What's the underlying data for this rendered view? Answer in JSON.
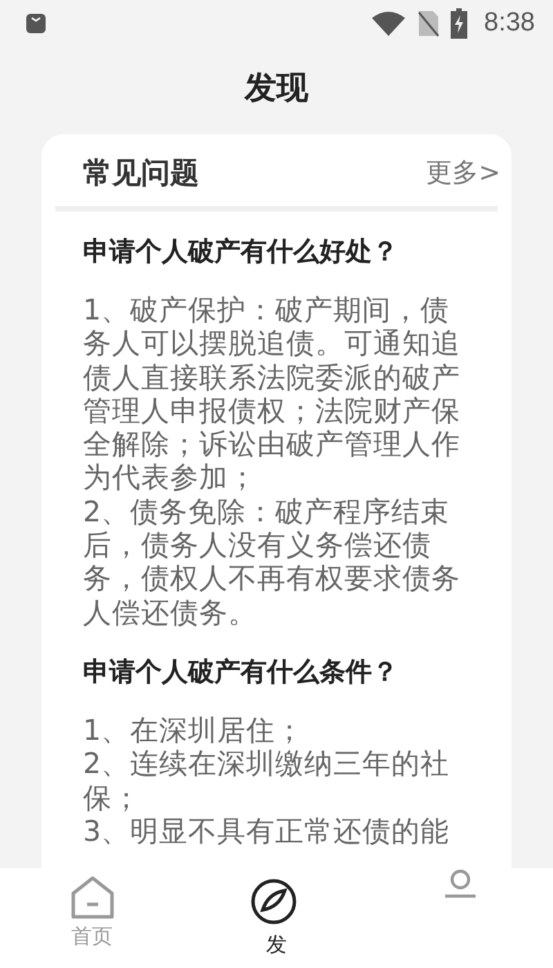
{
  "status_bar": {
    "time": "8:38"
  },
  "page_title": "发现",
  "faq": {
    "title": "常见问题",
    "more": "更多>",
    "items": [
      {
        "question": "申请个人破产有什么好处？",
        "answer": [
          "1、破产保护：破产期间，债务人可以摆脱追债。可通知追债人直接联系法院委派的破产管理人申报债权；法院财产保全解除；诉讼由破产管理人作为代表参加；",
          "2、债务免除：破产程序结束后，债务人没有义务偿还债务，债权人不再有权要求债务人偿还债务。"
        ]
      },
      {
        "question": "申请个人破产有什么条件？",
        "answer": [
          "1、在深圳居住；",
          "2、连续在深圳缴纳三年的社保；",
          "3、明显不具有正常还债的能"
        ]
      }
    ]
  },
  "tabs": [
    {
      "kind": "home",
      "label": "首页",
      "selected": false
    },
    {
      "kind": "discover",
      "label": "发",
      "selected": true
    },
    {
      "kind": "profile",
      "selected": false
    }
  ]
}
